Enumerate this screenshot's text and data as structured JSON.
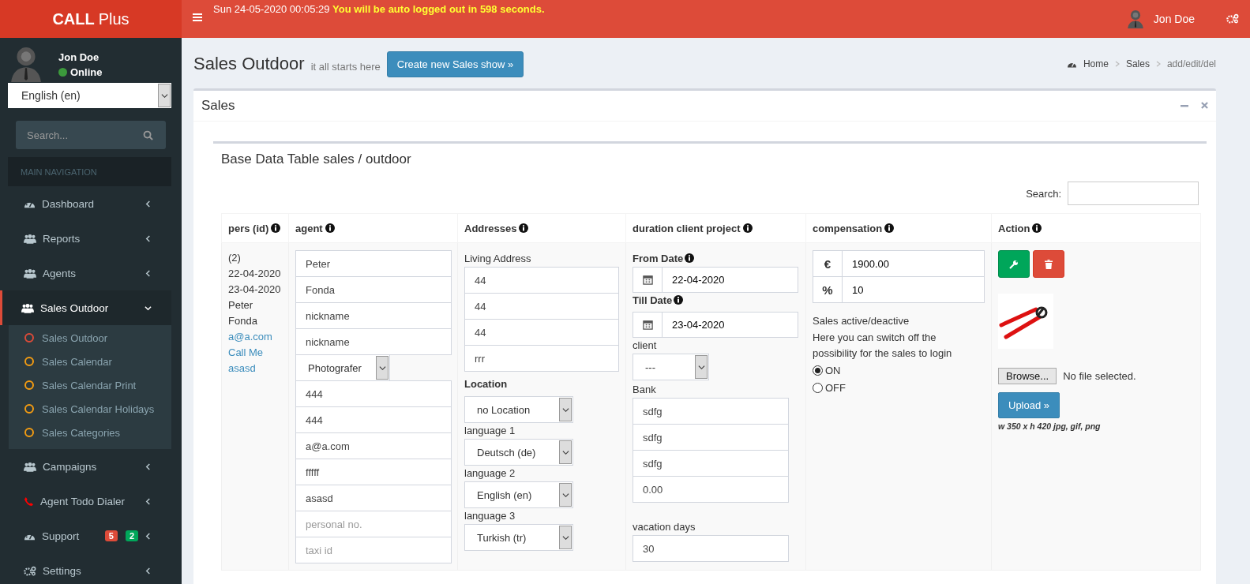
{
  "header": {
    "brand_bold": "CALL",
    "brand_rest": "Plus",
    "datetime": "Sun 24-05-2020 00:05:29",
    "logout_warning": "You will be auto logged out in 598 seconds.",
    "user_name": "Jon Doe"
  },
  "sidebar": {
    "user": {
      "name": "Jon Doe",
      "status": "Online"
    },
    "language_select": {
      "value": "English (en)"
    },
    "search": {
      "placeholder": "Search..."
    },
    "section_heading": "MAIN NAVIGATION",
    "items": [
      {
        "label": "Dashboard",
        "kind": "dashboard",
        "expanded": false
      },
      {
        "label": "Reports",
        "kind": "group",
        "expanded": false
      },
      {
        "label": "Agents",
        "kind": "group",
        "expanded": false
      },
      {
        "label": "Sales Outdoor",
        "kind": "group",
        "expanded": true,
        "children": [
          {
            "label": "Sales Outdoor",
            "color": "#dd4b39"
          },
          {
            "label": "Sales Calendar",
            "color": "#f39c12"
          },
          {
            "label": "Sales Calendar Print",
            "color": "#f39c12"
          },
          {
            "label": "Sales Calendar Holidays",
            "color": "#f39c12"
          },
          {
            "label": "Sales Categories",
            "color": "#f39c12"
          }
        ]
      },
      {
        "label": "Campaigns",
        "kind": "group",
        "expanded": false
      },
      {
        "label": "Agent Todo Dialer",
        "kind": "dialer",
        "expanded": false
      },
      {
        "label": "Support",
        "kind": "dashboard",
        "expanded": false,
        "badges": [
          {
            "text": "5",
            "color": "#dd4b39"
          },
          {
            "text": "2",
            "color": "#00a65a"
          }
        ]
      },
      {
        "label": "Settings",
        "kind": "settings",
        "expanded": false
      }
    ]
  },
  "content_header": {
    "title": "Sales Outdoor",
    "subtitle": "it all starts here",
    "create_button": "Create new Sales show »",
    "breadcrumb": [
      "Home",
      "Sales",
      "add/edit/del"
    ]
  },
  "box": {
    "title": "Sales",
    "inner_title": "Base Data Table sales / outdoor",
    "search_label": "Search:"
  },
  "table": {
    "columns": [
      "pers (id)",
      "agent",
      "Addresses",
      "duration client project",
      "compensation",
      "Action"
    ],
    "row": {
      "pers": [
        {
          "kind": "text",
          "text": "(2)"
        },
        {
          "kind": "text",
          "text": "22-04-2020"
        },
        {
          "kind": "text",
          "text": "23-04-2020"
        },
        {
          "kind": "text",
          "text": "Peter"
        },
        {
          "kind": "text",
          "text": "Fonda"
        },
        {
          "kind": "link",
          "text": "a@a.com"
        },
        {
          "kind": "link",
          "text": "Call Me"
        },
        {
          "kind": "link",
          "text": "asasd"
        }
      ],
      "agent": [
        {
          "kind": "input",
          "value": "Peter"
        },
        {
          "kind": "input",
          "value": "Fonda"
        },
        {
          "kind": "input",
          "value": "nickname"
        },
        {
          "kind": "input",
          "value": "nickname"
        },
        {
          "kind": "select",
          "value": "Photografer"
        },
        {
          "kind": "input",
          "value": "444"
        },
        {
          "kind": "input",
          "value": "444"
        },
        {
          "kind": "input",
          "value": "a@a.com"
        },
        {
          "kind": "input",
          "value": "fffff"
        },
        {
          "kind": "input",
          "value": "asasd"
        },
        {
          "kind": "input",
          "placeholder": "personal no."
        },
        {
          "kind": "input",
          "placeholder": "taxi id"
        }
      ],
      "addresses": {
        "label": "Living Address",
        "fields": [
          "44",
          "44",
          "44",
          "rrr"
        ],
        "location": {
          "label": "Location",
          "value": "no Location"
        },
        "languages": [
          {
            "label": "language 1",
            "value": "Deutsch (de)"
          },
          {
            "label": "language 2",
            "value": "English (en)"
          },
          {
            "label": "language 3",
            "value": "Turkish (tr)"
          }
        ]
      },
      "duration": {
        "from_date": {
          "label": "From Date",
          "value": "22-04-2020"
        },
        "till_date": {
          "label": "Till Date",
          "value": "23-04-2020"
        },
        "client": {
          "label": "client",
          "value": "---"
        },
        "bank": {
          "label": "Bank",
          "fields": [
            "sdfg",
            "sdfg",
            "sdfg",
            "0.00"
          ]
        },
        "vacation": {
          "label": "vacation days",
          "value": "30"
        }
      },
      "compensation": {
        "amount": {
          "symbol": "€",
          "value": "1900.00"
        },
        "percent": {
          "symbol": "%",
          "value": "10"
        },
        "heading": "Sales active/deactive",
        "description": "Here you can switch off the possibility for the sales to login",
        "radios": [
          {
            "label": "ON",
            "selected": true
          },
          {
            "label": "OFF",
            "selected": false
          }
        ]
      },
      "action": {
        "browse_button": "Browse...",
        "file_status": "No file selected.",
        "upload_button": "Upload »",
        "hint": "w 350 x h 420 jpg, gif, png"
      }
    }
  }
}
